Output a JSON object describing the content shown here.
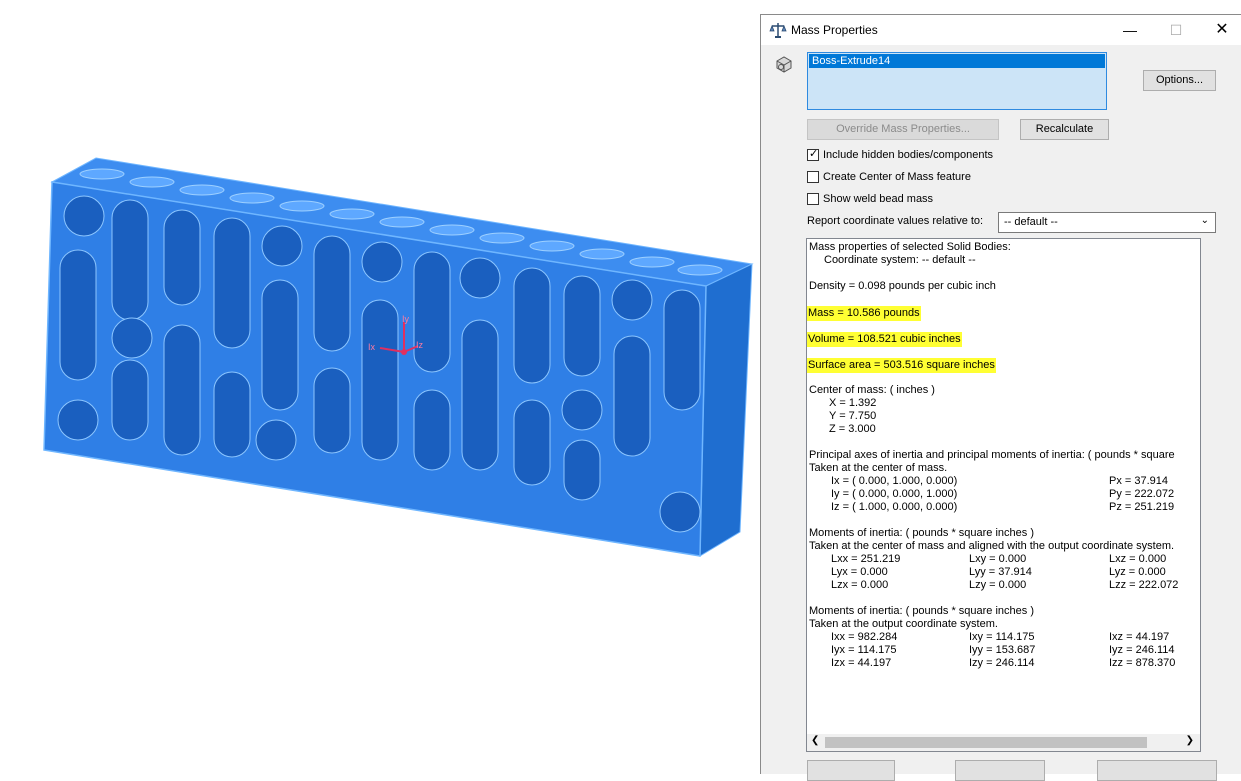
{
  "dialog": {
    "title": "Mass Properties",
    "selection": "Boss-Extrude14",
    "options_label": "Options...",
    "override_label": "Override Mass Properties...",
    "recalculate_label": "Recalculate",
    "checks": [
      {
        "label": "Include hidden bodies/components",
        "checked": true
      },
      {
        "label": "Create Center of Mass feature",
        "checked": false
      },
      {
        "label": "Show weld bead mass",
        "checked": false
      }
    ],
    "coord_label": "Report coordinate values relative to:",
    "coord_value": "-- default --",
    "highlight_color": "#ffff33"
  },
  "results": {
    "header1": "Mass properties of selected Solid Bodies:",
    "header2": "Coordinate system: -- default --",
    "density": "Density = 0.098 pounds per cubic inch",
    "mass": "Mass = 10.586 pounds",
    "volume": "Volume = 108.521 cubic inches",
    "surface_area": "Surface area = 503.516 square inches",
    "com_title": "Center of mass: ( inches )",
    "com_x": "X = 1.392",
    "com_y": "Y = 7.750",
    "com_z": "Z = 3.000",
    "principal_title": "Principal axes of inertia and principal moments of inertia: ( pounds * square",
    "principal_sub": "Taken at the center of mass.",
    "ix": "Ix = ( 0.000,  1.000,  0.000)",
    "iy": "Iy = ( 0.000,  0.000,  1.000)",
    "iz": "Iz = ( 1.000,  0.000,  0.000)",
    "px": "Px = 37.914",
    "py": "Py = 222.072",
    "pz": "Pz = 251.219",
    "moi1_title": "Moments of inertia: ( pounds * square inches )",
    "moi1_sub": "Taken at the center of mass and aligned with the output coordinate system.",
    "lxx": "Lxx = 251.219",
    "lxy": "Lxy = 0.000",
    "lxz": "Lxz = 0.000",
    "lyx": "Lyx = 0.000",
    "lyy": "Lyy = 37.914",
    "lyz": "Lyz = 0.000",
    "lzx": "Lzx = 0.000",
    "lzy": "Lzy = 0.000",
    "lzz": "Lzz = 222.072",
    "moi2_title": "Moments of inertia: ( pounds * square inches )",
    "moi2_sub": "Taken at the output coordinate system.",
    "ixx": "Ixx = 982.284",
    "ixy": "Ixy = 114.175",
    "ixz": "Ixz = 44.197",
    "iyx": "Iyx = 114.175",
    "iyy": "Iyy = 153.687",
    "iyz": "Iyz = 246.114",
    "izx": "Izx = 44.197",
    "izy": "Izy = 246.114",
    "izz": "Izz = 878.370"
  },
  "viewport": {
    "model_color": "#2f7fe6",
    "edge_color": "#4ea6ff",
    "triad": {
      "y_label": "Iy",
      "x_label": "Ix",
      "z_label": "Iz"
    }
  }
}
